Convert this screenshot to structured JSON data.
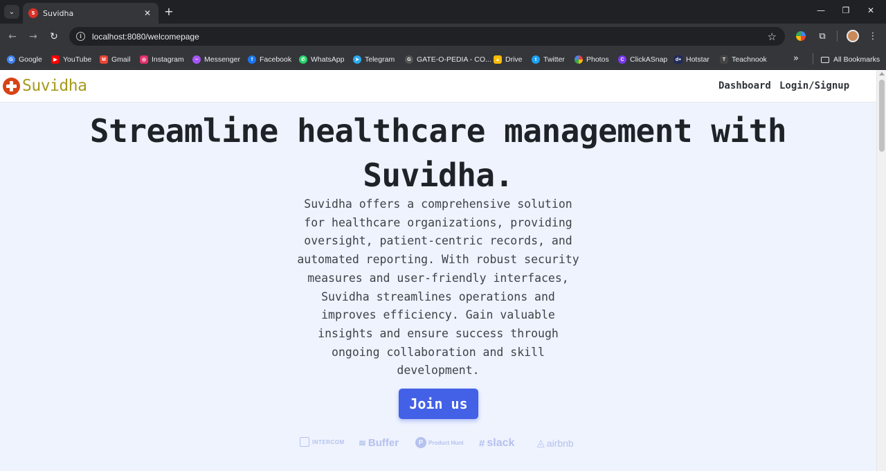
{
  "browser": {
    "tab_title": "Suvidha",
    "tab_favicon_text": "S",
    "url": "localhost:8080/welcomepage",
    "new_tab_glyph": "+",
    "close_glyph": "✕",
    "window_controls": [
      "—",
      "❐",
      "✕"
    ]
  },
  "bookmarks": {
    "items": [
      {
        "label": "Google",
        "icon": "google-icon",
        "color": "#4285f4"
      },
      {
        "label": "YouTube",
        "icon": "youtube-icon",
        "color": "#ff0000"
      },
      {
        "label": "Gmail",
        "icon": "gmail-icon",
        "color": "#ea4335"
      },
      {
        "label": "Instagram",
        "icon": "instagram-icon",
        "color": "#e1306c"
      },
      {
        "label": "Messenger",
        "icon": "messenger-icon",
        "color": "#a855f7"
      },
      {
        "label": "Facebook",
        "icon": "facebook-icon",
        "color": "#1877f2"
      },
      {
        "label": "WhatsApp",
        "icon": "whatsapp-icon",
        "color": "#25d366"
      },
      {
        "label": "Telegram",
        "icon": "telegram-icon",
        "color": "#2aabee"
      },
      {
        "label": "GATE-O-PEDIA - CO...",
        "icon": "gateopedia-icon",
        "color": "#555555"
      },
      {
        "label": "Drive",
        "icon": "drive-icon",
        "color": "#fbbc05"
      },
      {
        "label": "Twitter",
        "icon": "twitter-icon",
        "color": "#1da1f2"
      },
      {
        "label": "Photos",
        "icon": "photos-icon",
        "color": "#ea4335"
      },
      {
        "label": "ClickASnap",
        "icon": "clickasnap-icon",
        "color": "#7c3aed"
      },
      {
        "label": "Hotstar",
        "icon": "hotstar-icon",
        "color": "#1f2a5c"
      },
      {
        "label": "Teachnook",
        "icon": "teachnook-icon",
        "color": "#444444"
      }
    ],
    "more_glyph": "»",
    "all_bookmarks": "All Bookmarks"
  },
  "site": {
    "brand": "Suvidha",
    "nav": {
      "dashboard": "Dashboard",
      "login": "Login/Signup"
    },
    "hero_title_line1": "Streamline healthcare management with",
    "hero_title_line2": "Suvidha.",
    "hero_description": "Suvidha offers a comprehensive solution for healthcare organizations, providing oversight, patient-centric records, and automated reporting. With robust security measures and user-friendly interfaces, Suvidha streamlines operations and improves efficiency. Gain valuable insights and ensure success through ongoing collaboration and skill development.",
    "cta_label": "Join us",
    "partner_logos": [
      "INTERCOM",
      "Buffer",
      "Product Hunt",
      "slack",
      "airbnb"
    ]
  },
  "colors": {
    "brand_text": "#a59a1c",
    "brand_logo": "#d84315",
    "cta": "#4361e6",
    "page_bg": "#eef3fe",
    "logo_tint": "#b5c1ee"
  }
}
